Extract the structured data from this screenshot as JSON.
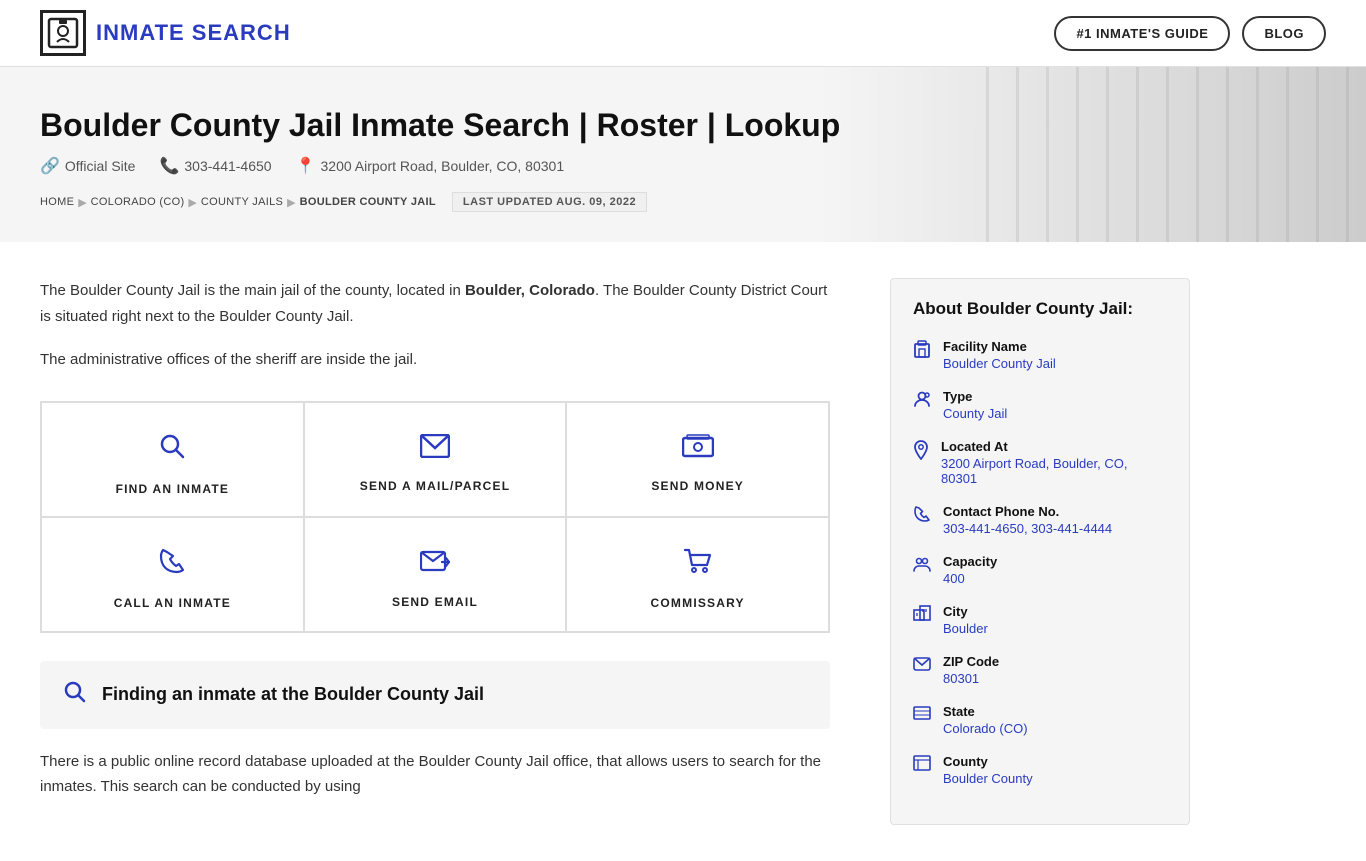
{
  "header": {
    "logo_text": "INMATE SEARCH",
    "logo_icon": "🔒",
    "nav": {
      "guide_label": "#1 INMATE'S GUIDE",
      "blog_label": "BLOG"
    }
  },
  "hero": {
    "title": "Boulder County Jail Inmate Search | Roster | Lookup",
    "official_site_label": "Official Site",
    "phone": "303-441-4650",
    "address": "3200 Airport Road, Boulder, CO, 80301",
    "breadcrumb": {
      "items": [
        "HOME",
        "COLORADO (CO)",
        "COUNTY JAILS",
        "BOULDER COUNTY JAIL"
      ]
    },
    "last_updated": "LAST UPDATED AUG. 09, 2022"
  },
  "content": {
    "intro_p1": "The Boulder County Jail is the main jail of the county, located in ",
    "intro_p1_bold": "Boulder, Colorado",
    "intro_p1_end": ".",
    "intro_p2": "The Boulder County District Court is situated right next to the Boulder County Jail.",
    "intro_p3": "The administrative offices of the sheriff are inside the jail.",
    "actions": [
      {
        "id": "find-inmate",
        "icon": "🔍",
        "label": "FIND AN INMATE"
      },
      {
        "id": "send-mail",
        "icon": "✉",
        "label": "SEND A MAIL/PARCEL"
      },
      {
        "id": "send-money",
        "icon": "💳",
        "label": "SEND MONEY"
      },
      {
        "id": "call-inmate",
        "icon": "📞",
        "label": "CALL AN INMATE"
      },
      {
        "id": "send-email",
        "icon": "💬",
        "label": "SEND EMAIL"
      },
      {
        "id": "commissary",
        "icon": "🛒",
        "label": "COMMISSARY"
      }
    ],
    "finding_heading": "Finding an inmate at the Boulder County Jail",
    "body_text": "There is a public online record database uploaded at the Boulder County Jail office, that allows users to search for the inmates. This search can be conducted by using"
  },
  "sidebar": {
    "heading": "About Boulder County Jail:",
    "items": [
      {
        "icon": "🏢",
        "label": "Facility Name",
        "value": "Boulder County Jail"
      },
      {
        "icon": "👤",
        "label": "Type",
        "value": "County Jail"
      },
      {
        "icon": "📍",
        "label": "Located At",
        "value": "3200 Airport Road, Boulder, CO, 80301"
      },
      {
        "icon": "📞",
        "label": "Contact Phone No.",
        "value": "303-441-4650, 303-441-4444"
      },
      {
        "icon": "👥",
        "label": "Capacity",
        "value": "400"
      },
      {
        "icon": "🏙",
        "label": "City",
        "value": "Boulder"
      },
      {
        "icon": "✉",
        "label": "ZIP Code",
        "value": "80301"
      },
      {
        "icon": "🗺",
        "label": "State",
        "value": "Colorado (CO)"
      },
      {
        "icon": "📋",
        "label": "County",
        "value": "Boulder County"
      }
    ]
  }
}
